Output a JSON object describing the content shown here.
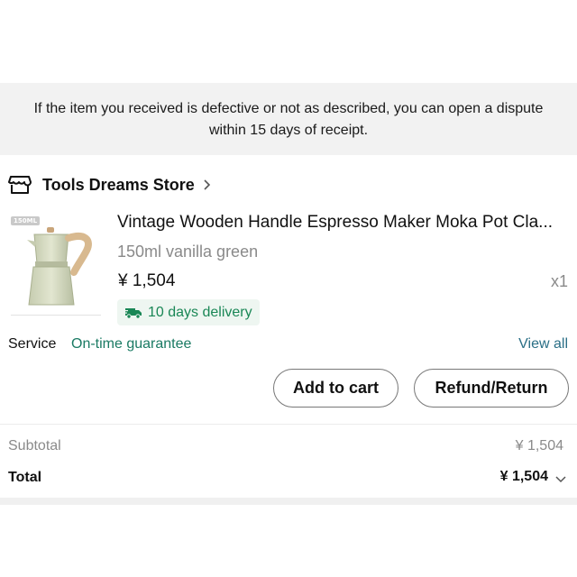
{
  "notice": {
    "line1": "If the item you received is defective or not as described, you can open a dispute",
    "line2": "within 15 days of receipt."
  },
  "store": {
    "name": "Tools Dreams Store",
    "icon": "store-icon"
  },
  "product": {
    "badge": "150ML",
    "title": "Vintage Wooden Handle Espresso Maker Moka Pot Cla...",
    "variant": "150ml vanilla green",
    "price": "¥ 1,504",
    "quantity": "x1",
    "delivery": "10 days delivery"
  },
  "service": {
    "label": "Service",
    "value": "On-time guarantee",
    "view_all": "View all"
  },
  "actions": {
    "add_to_cart": "Add to cart",
    "refund_return": "Refund/Return"
  },
  "summary": {
    "subtotal_label": "Subtotal",
    "subtotal_value": "¥ 1,504",
    "total_label": "Total",
    "total_value": "¥ 1,504"
  },
  "colors": {
    "accent_green": "#1a8756",
    "link_blue": "#2a6f86",
    "notice_bg": "#f2f2f2"
  }
}
